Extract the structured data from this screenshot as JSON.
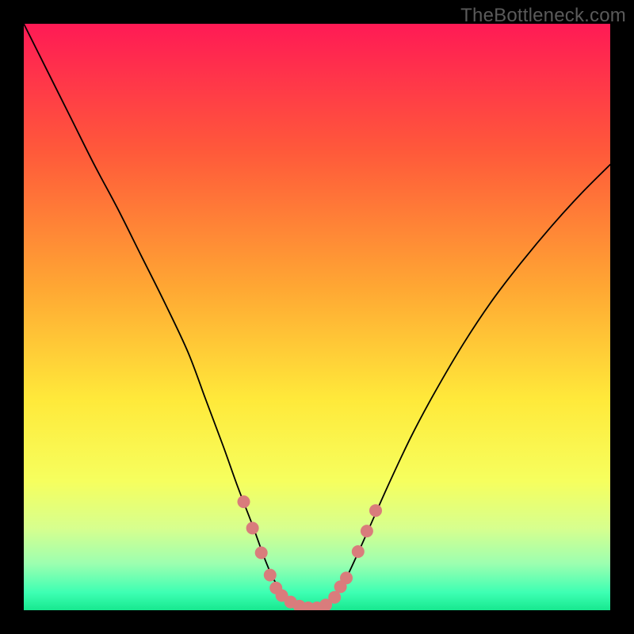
{
  "watermark": "TheBottleneck.com",
  "chart_data": {
    "type": "line",
    "title": "",
    "xlabel": "",
    "ylabel": "",
    "xlim": [
      0,
      100
    ],
    "ylim": [
      0,
      100
    ],
    "grid": false,
    "legend": false,
    "gradient_stops": [
      {
        "offset": 0,
        "color": "#ff1a55"
      },
      {
        "offset": 22,
        "color": "#ff5a3a"
      },
      {
        "offset": 45,
        "color": "#ffa733"
      },
      {
        "offset": 64,
        "color": "#ffe93a"
      },
      {
        "offset": 78,
        "color": "#f6ff5e"
      },
      {
        "offset": 86,
        "color": "#d7ff8e"
      },
      {
        "offset": 92,
        "color": "#9dffb0"
      },
      {
        "offset": 97,
        "color": "#3dffb3"
      },
      {
        "offset": 100,
        "color": "#17e88f"
      }
    ],
    "series": [
      {
        "name": "bottleneck-curve",
        "stroke": "#000000",
        "stroke_width": 1.8,
        "x": [
          0,
          4,
          8,
          12,
          16,
          20,
          24,
          28,
          31,
          34,
          36.5,
          39,
          41,
          42.5,
          44,
          46,
          48,
          50,
          51.5,
          53,
          55,
          58,
          62,
          66,
          70,
          75,
          80,
          85,
          90,
          95,
          100
        ],
        "y": [
          100,
          92,
          84,
          76,
          68.5,
          60.5,
          52.5,
          44,
          36,
          28,
          21,
          14.5,
          9,
          5.5,
          3.2,
          1.6,
          0.7,
          0.4,
          0.8,
          2.2,
          5.5,
          12,
          21,
          29.5,
          37,
          45.5,
          53,
          59.5,
          65.5,
          71,
          76
        ]
      }
    ],
    "markers": {
      "name": "highlight-dots",
      "fill": "#d97c7c",
      "radius": 8,
      "points": [
        {
          "x": 37.5,
          "y": 18.5
        },
        {
          "x": 39.0,
          "y": 14.0
        },
        {
          "x": 40.5,
          "y": 9.8
        },
        {
          "x": 42.0,
          "y": 6.0
        },
        {
          "x": 43.0,
          "y": 3.8
        },
        {
          "x": 44.0,
          "y": 2.5
        },
        {
          "x": 45.5,
          "y": 1.4
        },
        {
          "x": 47.0,
          "y": 0.7
        },
        {
          "x": 48.5,
          "y": 0.4
        },
        {
          "x": 50.0,
          "y": 0.4
        },
        {
          "x": 51.5,
          "y": 0.9
        },
        {
          "x": 53.0,
          "y": 2.2
        },
        {
          "x": 54.0,
          "y": 4.0
        },
        {
          "x": 55.0,
          "y": 5.5
        },
        {
          "x": 57.0,
          "y": 10.0
        },
        {
          "x": 58.5,
          "y": 13.5
        },
        {
          "x": 60.0,
          "y": 17.0
        }
      ]
    }
  }
}
